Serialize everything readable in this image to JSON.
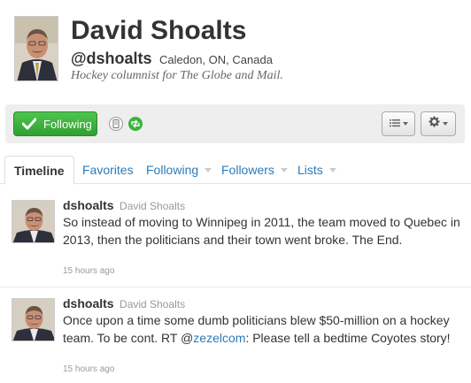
{
  "profile": {
    "name": "David Shoalts",
    "handle": "@dshoalts",
    "location": "Caledon, ON, Canada",
    "bio": "Hockey columnist for The Globe and Mail."
  },
  "actions": {
    "follow_label": "Following",
    "accent_color": "#3ab53a"
  },
  "tabs": [
    {
      "label": "Timeline",
      "active": true
    },
    {
      "label": "Favorites"
    },
    {
      "label": "Following"
    },
    {
      "label": "Followers"
    },
    {
      "label": "Lists"
    }
  ],
  "tweets": [
    {
      "screen_name": "dshoalts",
      "full_name": "David Shoalts",
      "text": "So instead of moving to Winnipeg in 2011, the team moved to Quebec in 2013, then the politicians and their town went broke. The End.",
      "time": "15 hours ago"
    },
    {
      "screen_name": "dshoalts",
      "full_name": "David Shoalts",
      "text_before": "Once upon a time some dumb politicians blew $50-million on a hockey team. To be cont. RT @",
      "mention": "zezelcom",
      "text_after": ": Please tell a bedtime Coyotes story!",
      "time": "15 hours ago"
    }
  ]
}
